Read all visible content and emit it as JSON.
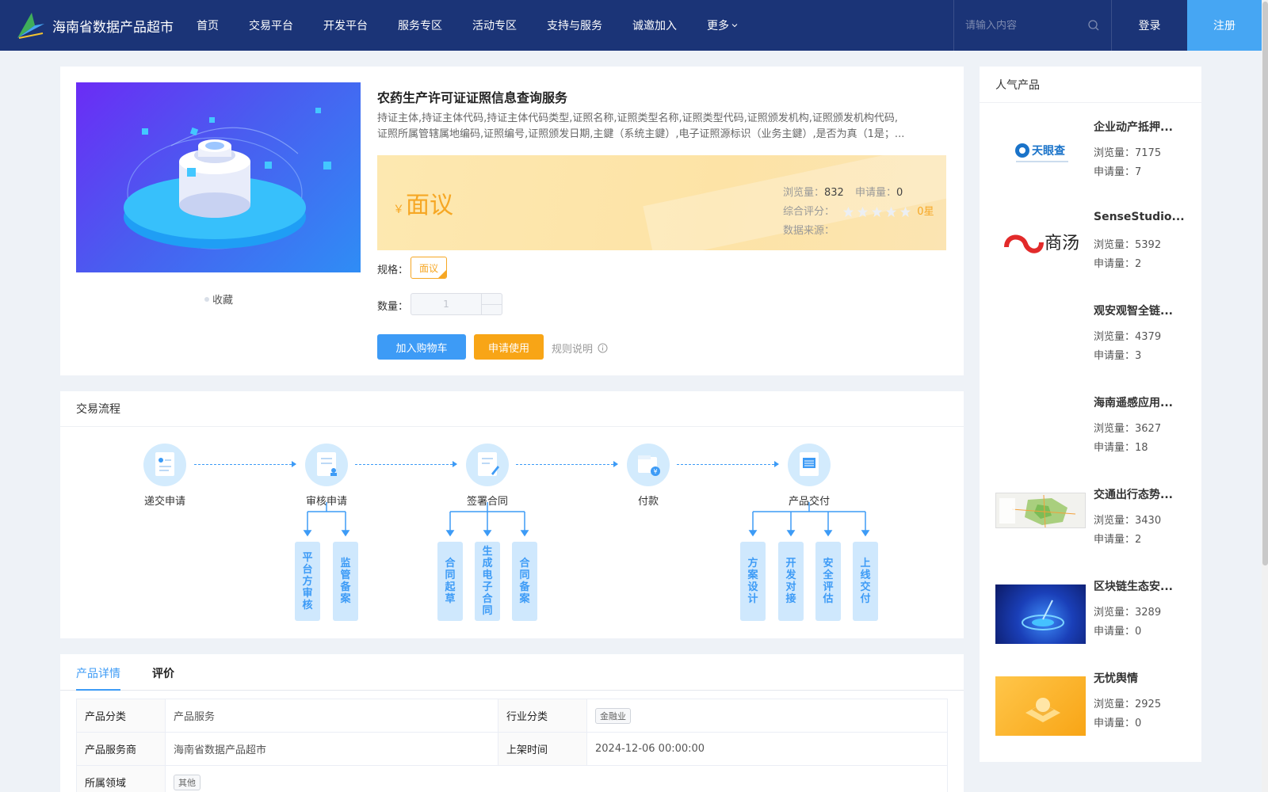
{
  "header": {
    "site_name": "海南省数据产品超市",
    "nav": [
      "首页",
      "交易平台",
      "开发平台",
      "服务专区",
      "活动专区",
      "支持与服务",
      "诚邀加入",
      "更多"
    ],
    "search_placeholder": "请输入内容",
    "login": "登录",
    "register": "注册",
    "colors": {
      "bar": "#1b3477",
      "register": "#46a6f3"
    }
  },
  "product": {
    "title": "农药生产许可证证照信息查询服务",
    "desc_line1": "持证主体,持证主体代码,持证主体代码类型,证照名称,证照类型名称,证照类型代码,证照颁发机构,证照颁发机构代码,",
    "desc_line2": "证照所属管辖属地编码,证照编号,证照颁发日期,主鍵（系统主鍵）,电子证照源标识（业务主鍵）,是否为真（1是；...",
    "favorite": "收藏",
    "price_symbol": "￥",
    "price": "面议",
    "views_label": "浏览量：",
    "views": "832",
    "apply_label": "申请量：",
    "apply": "0",
    "rating_label": "综合评分：",
    "rating_stars": 0,
    "rating_text": "0星",
    "source_label": "数据来源：",
    "spec_label": "规格：",
    "spec_value": "面议",
    "qty_label": "数量：",
    "qty_value": "1",
    "btn_cart": "加入购物车",
    "btn_apply": "申请使用",
    "rules": "规则说明",
    "accent": "#f6a724"
  },
  "process": {
    "title": "交易流程",
    "steps": [
      "递交申请",
      "审核申请",
      "签署合同",
      "付款",
      "产品交付"
    ],
    "sub": {
      "review": [
        "平台方审核",
        "监管备案"
      ],
      "contract": [
        "合同起草",
        "生成电子合同",
        "合同备案"
      ],
      "delivery": [
        "方案设计",
        "开发对接",
        "安全评估",
        "上线交付"
      ]
    }
  },
  "details": {
    "tabs": [
      "产品详情",
      "评价"
    ],
    "rows": {
      "category_k": "产品分类",
      "category_v": "产品服务",
      "industry_k": "行业分类",
      "industry_v": "金融业",
      "provider_k": "产品服务商",
      "provider_v": "海南省数据产品超市",
      "listed_k": "上架时间",
      "listed_v": "2024-12-06 00:00:00",
      "domain_k": "所属领域",
      "domain_v": "其他"
    }
  },
  "side": {
    "title": "人气产品",
    "views_label": "浏览量：",
    "apply_label": "申请量：",
    "items": [
      {
        "name": "企业动产抵押...",
        "views": "7175",
        "apply": "7",
        "thumb": "tianyancha-logo",
        "logo_text": "天眼查"
      },
      {
        "name": "SenseStudio...",
        "views": "5392",
        "apply": "2",
        "thumb": "sensetime-logo",
        "logo_text": "商汤"
      },
      {
        "name": "观安观智全链...",
        "views": "4379",
        "apply": "3",
        "thumb": "blank"
      },
      {
        "name": "海南遥感应用...",
        "views": "3627",
        "apply": "18",
        "thumb": "blank"
      },
      {
        "name": "交通出行态势...",
        "views": "3430",
        "apply": "2",
        "thumb": "map-thumbnail"
      },
      {
        "name": "区块链生态安...",
        "views": "3289",
        "apply": "0",
        "thumb": "blockchain-thumbnail"
      },
      {
        "name": "无忧舆情",
        "views": "2925",
        "apply": "0",
        "thumb": "yuqing-thumbnail"
      }
    ]
  }
}
